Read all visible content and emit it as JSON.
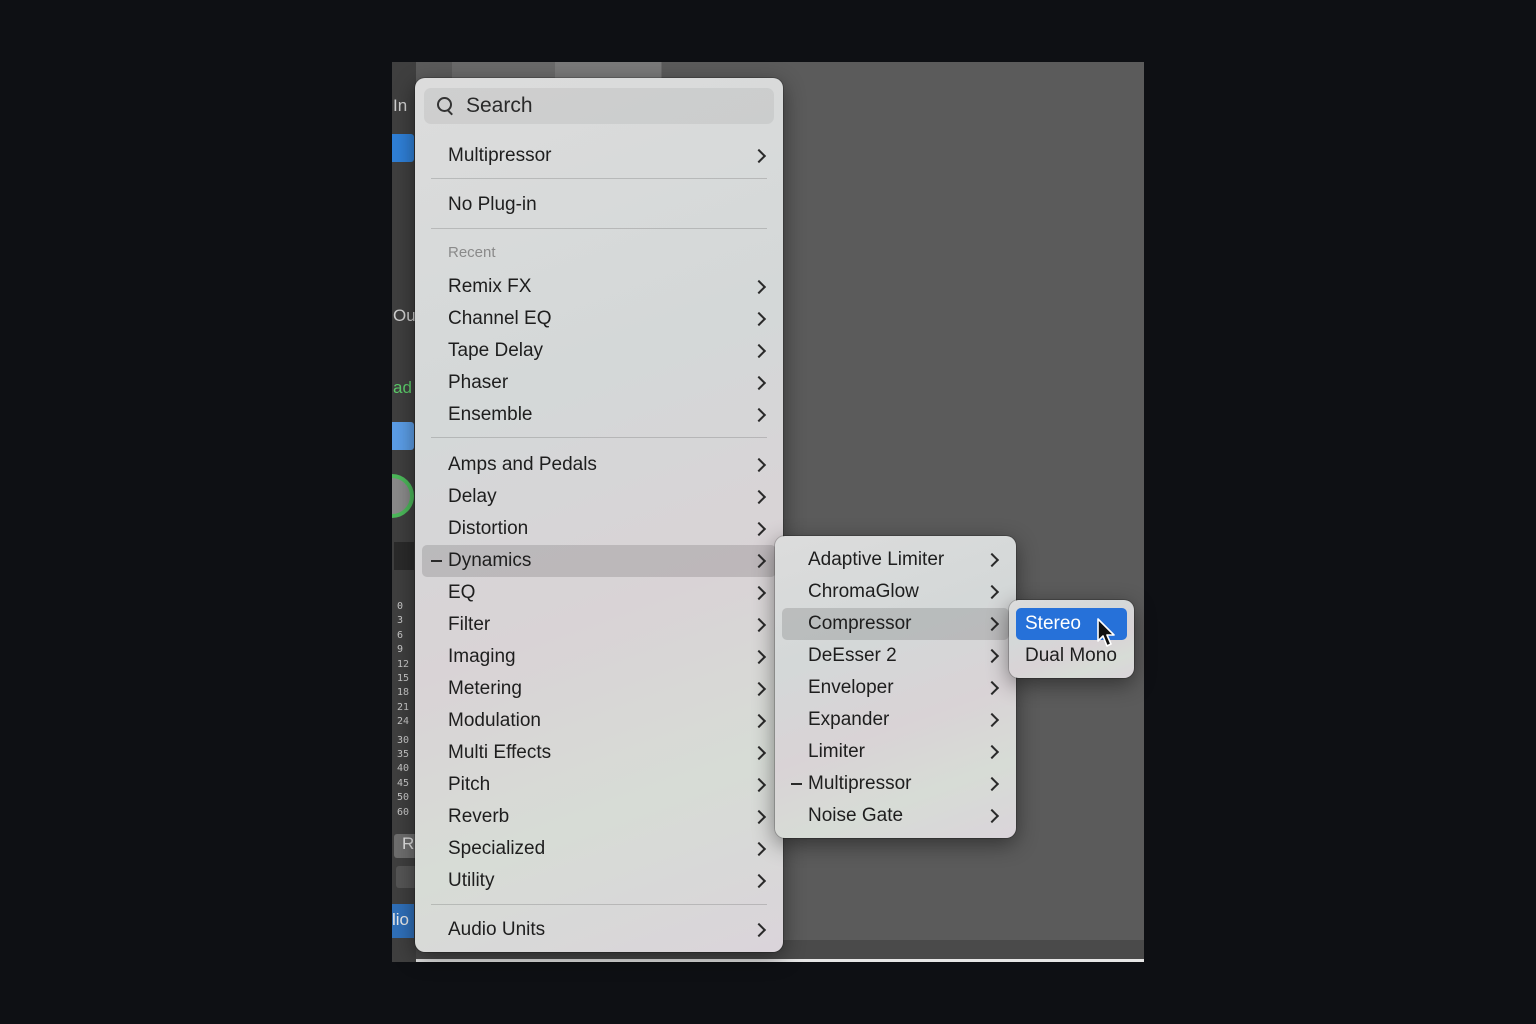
{
  "side_strip": {
    "label_top": "In",
    "label_out": "Ou",
    "label_green": "ad",
    "label_r": "R",
    "label_bottom": "lio",
    "scale": [
      "0",
      "3",
      "6",
      "9",
      "12",
      "15",
      "18",
      "21",
      "24",
      "30",
      "35",
      "40",
      "45",
      "50",
      "60"
    ]
  },
  "search": {
    "placeholder": "Search"
  },
  "main_menu": {
    "top_item": "Multipressor",
    "no_plugin": "No Plug-in",
    "recent_header": "Recent",
    "recent": [
      "Remix FX",
      "Channel EQ",
      "Tape Delay",
      "Phaser",
      "Ensemble"
    ],
    "categories": [
      "Amps and Pedals",
      "Delay",
      "Distortion",
      "Dynamics",
      "EQ",
      "Filter",
      "Imaging",
      "Metering",
      "Modulation",
      "Multi Effects",
      "Pitch",
      "Reverb",
      "Specialized",
      "Utility"
    ],
    "audio_units": "Audio Units",
    "highlighted": "Dynamics"
  },
  "dynamics_menu": {
    "items": [
      "Adaptive Limiter",
      "ChromaGlow",
      "Compressor",
      "DeEsser 2",
      "Enveloper",
      "Expander",
      "Limiter",
      "Multipressor",
      "Noise Gate"
    ],
    "highlighted": "Compressor",
    "current": "Multipressor"
  },
  "compressor_menu": {
    "items": [
      "Stereo",
      "Dual Mono"
    ],
    "selected": "Stereo"
  },
  "colors": {
    "selection": "#2671d9",
    "menu_bg": "#dadada",
    "app_bg": "#5b5b5b"
  }
}
